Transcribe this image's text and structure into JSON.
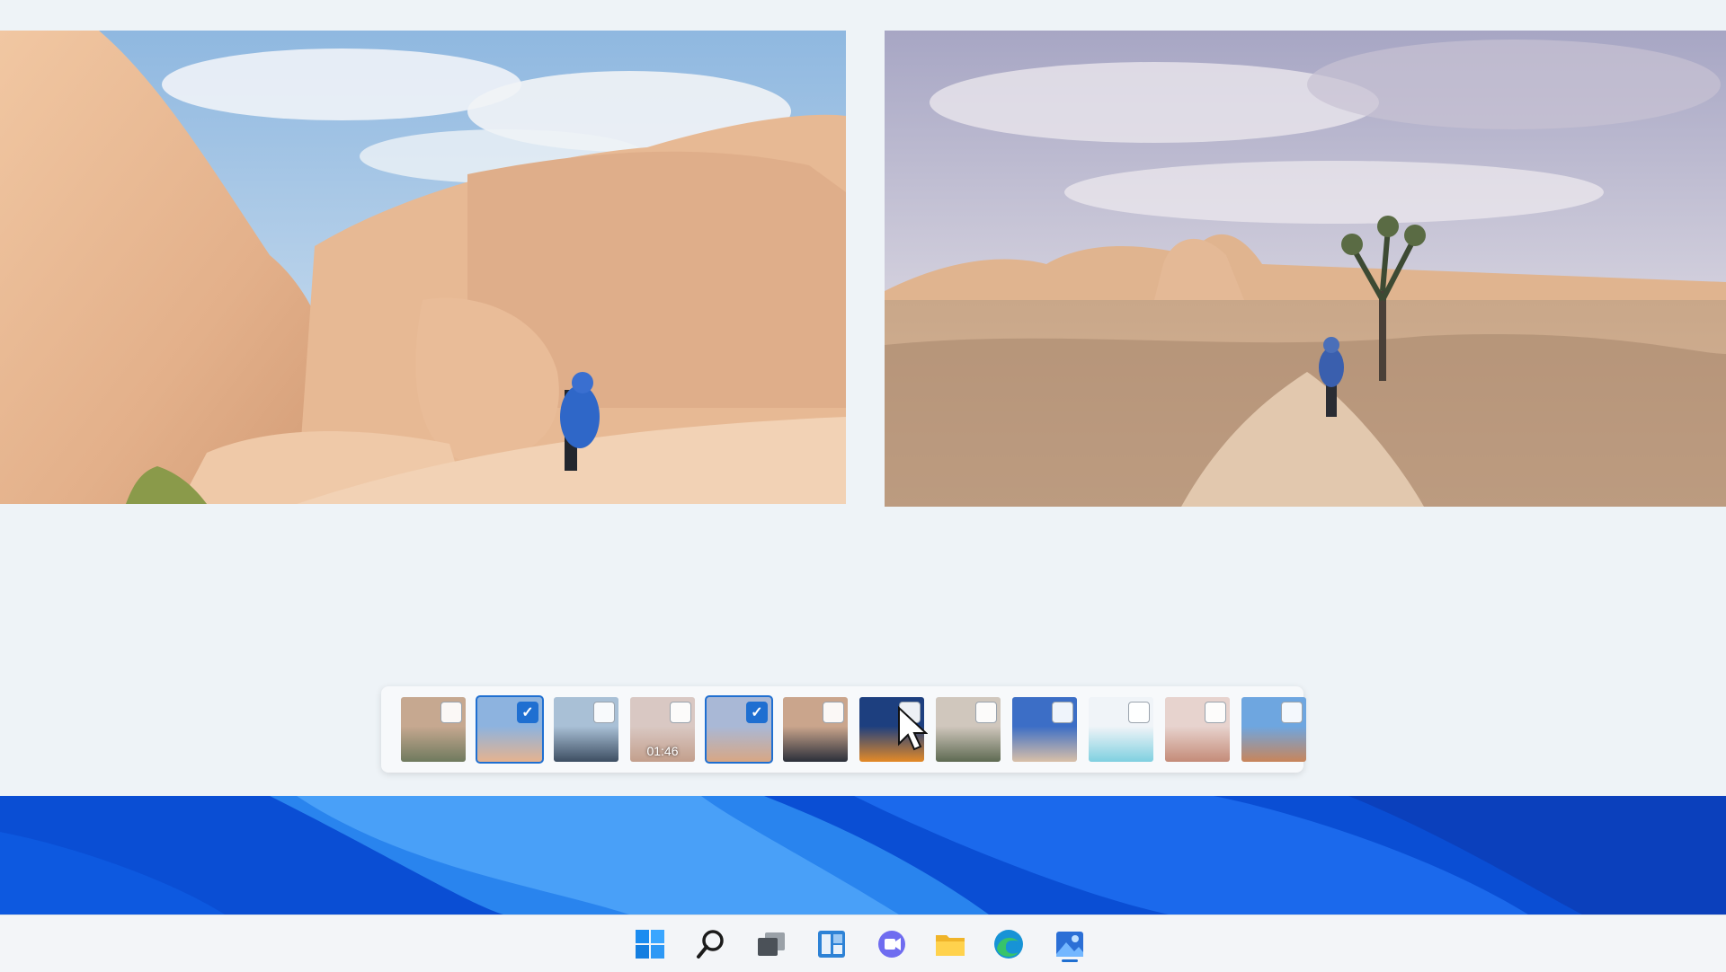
{
  "photos_app": {
    "main_photos": [
      {
        "name": "desert-rock-hiker-photo",
        "icon": "photo-image"
      },
      {
        "name": "joshua-tree-trail-photo",
        "icon": "photo-image"
      }
    ],
    "filmstrip": {
      "thumbnails": [
        {
          "selected": false,
          "duration": ""
        },
        {
          "selected": true,
          "duration": ""
        },
        {
          "selected": false,
          "duration": ""
        },
        {
          "selected": false,
          "duration": "01:46"
        },
        {
          "selected": true,
          "duration": ""
        },
        {
          "selected": false,
          "duration": ""
        },
        {
          "selected": false,
          "duration": ""
        },
        {
          "selected": false,
          "duration": ""
        },
        {
          "selected": false,
          "duration": ""
        },
        {
          "selected": false,
          "duration": ""
        },
        {
          "selected": false,
          "duration": ""
        },
        {
          "selected": false,
          "duration": ""
        }
      ],
      "check_mark": "✓"
    }
  },
  "taskbar": {
    "icons": [
      "start-icon",
      "search-icon",
      "task-view-icon",
      "widgets-icon",
      "chat-icon",
      "file-explorer-icon",
      "edge-icon",
      "photos-icon"
    ],
    "active": "photos-icon"
  },
  "colors": {
    "accent": "#1f6fd1",
    "app_background": "#eef3f7",
    "wallpaper": "#0a4fd6"
  }
}
